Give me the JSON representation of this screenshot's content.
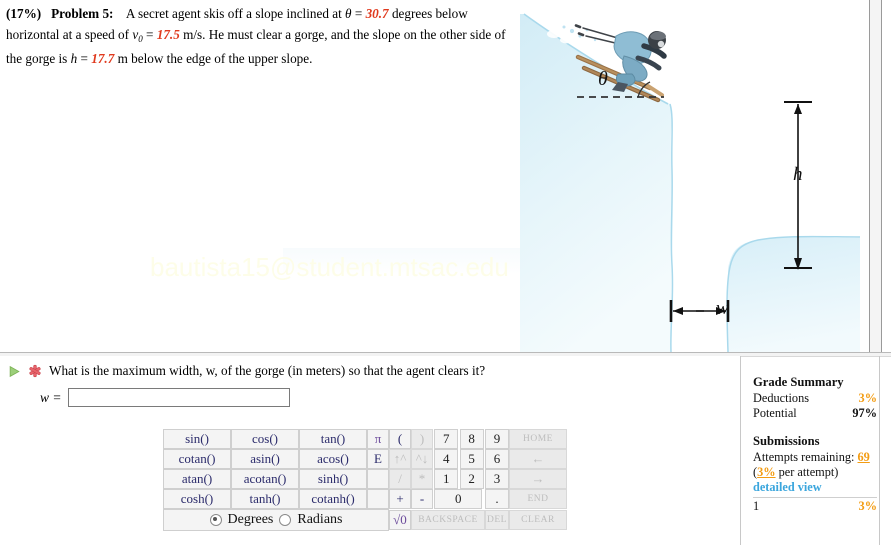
{
  "problem": {
    "percent": "(17%)",
    "label": "Problem 5:",
    "body_1": "A secret agent skis off a slope inclined at ",
    "theta_sym": "θ",
    "eq1": " = ",
    "theta_val": "30.7",
    "body_2": " degrees below horizontal at a speed of ",
    "v_sym": "v",
    "v_sub": "0",
    "eq2": " = ",
    "v_val": "17.5",
    "body_3": " m/s. He must clear a gorge, and the slope on the other side of the gorge is ",
    "h_sym": "h",
    "eq3": " = ",
    "h_val": "17.7",
    "body_4": " m below the edge of the upper slope."
  },
  "figure": {
    "theta_label": "θ",
    "h_label": "h",
    "w_label": "w",
    "slope_color": "#dcf0f7",
    "outline_color": "#a8d8ea",
    "ski_color": "#9a7247",
    "suit_color": "#7fb4cc"
  },
  "watermark": {
    "text": "bautista15@student.mtsac.edu"
  },
  "question": {
    "play_icon": "play-triangle-icon",
    "status_icon": "red-star-incorrect-icon",
    "text": "What is the maximum width, w, of the gorge (in meters) so that the agent clears it?",
    "answer_label": "w =",
    "answer_value": "",
    "answer_placeholder": ""
  },
  "keypad": {
    "functions": [
      [
        "sin()",
        "cos()",
        "tan()"
      ],
      [
        "cotan()",
        "asin()",
        "acos()"
      ],
      [
        "atan()",
        "acotan()",
        "sinh()"
      ],
      [
        "cosh()",
        "tanh()",
        "cotanh()"
      ]
    ],
    "mode": {
      "degrees_label": "Degrees",
      "radians_label": "Radians",
      "selected": "Degrees"
    },
    "constants": [
      "π",
      "E",
      "",
      ""
    ],
    "row1": {
      "paren_open": "(",
      "paren_close": ")",
      "n7": "7",
      "n8": "8",
      "n9": "9",
      "action": "HOME"
    },
    "row2": {
      "up": "↑^",
      "down": "^↓",
      "n4": "4",
      "n5": "5",
      "n6": "6",
      "action": "←"
    },
    "row3": {
      "divide": "/",
      "multiply": "*",
      "n1": "1",
      "n2": "2",
      "n3": "3",
      "action": "→"
    },
    "row4": {
      "plus": "+",
      "minus": "-",
      "zero": "0",
      "dot": ".",
      "action": "END"
    },
    "row5": {
      "sqrt": "√0",
      "backspace": "BACKSPACE",
      "del": "DEL",
      "clear": "CLEAR"
    }
  },
  "grade": {
    "summary_title": "Grade Summary",
    "deductions_label": "Deductions",
    "deductions_value": "3%",
    "potential_label": "Potential",
    "potential_value": "97%",
    "submissions_title": "Submissions",
    "attempts_label": "Attempts remaining:",
    "attempts_value": "69",
    "per_attempt": "(3% per attempt)",
    "per_attempt_pct": "3%",
    "per_attempt_pre": "(",
    "per_attempt_post": " per attempt)",
    "detailed_view": "detailed view",
    "row_index": "1",
    "row_value": "3%"
  }
}
